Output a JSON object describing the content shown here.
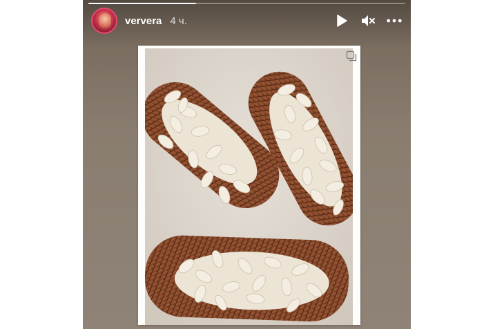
{
  "story": {
    "username": "ververa",
    "time_ago": "4 ч.",
    "progress": 0.34,
    "avatar_icon": "user-avatar",
    "controls": {
      "play_icon": "play-icon",
      "mute_icon": "muted-speaker-icon",
      "more_icon": "more-options-icon"
    },
    "media": {
      "corner_icon": "copy-icon"
    }
  },
  "colors": {
    "story_bg": "#857769",
    "eclair": "#8b4a2c",
    "almond": "#f2ece0"
  }
}
